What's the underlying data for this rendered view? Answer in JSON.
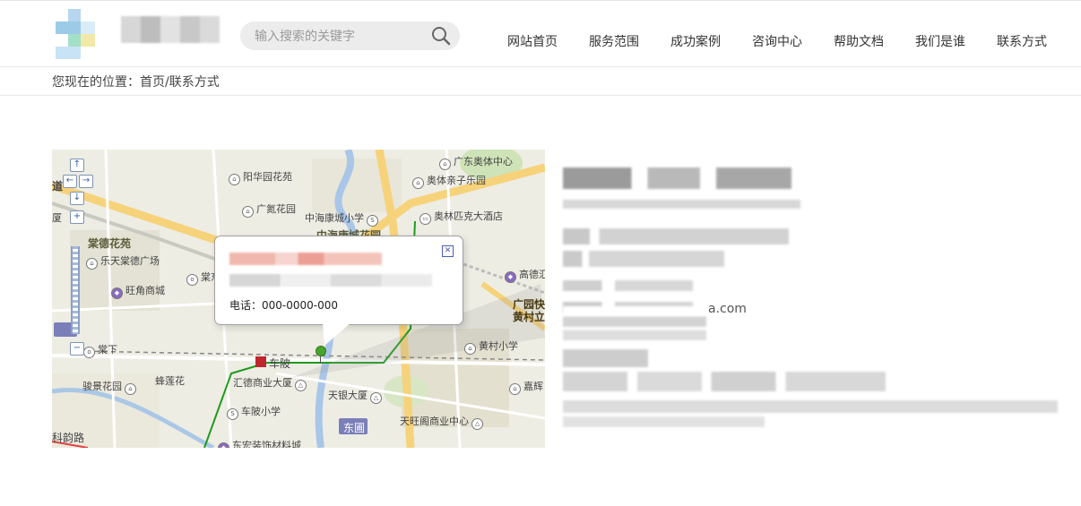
{
  "header": {
    "search": {
      "placeholder": "输入搜索的关键字"
    },
    "nav": [
      "网站首页",
      "服务范围",
      "成功案例",
      "咨询中心",
      "帮助文档",
      "我们是谁",
      "联系方式"
    ]
  },
  "breadcrumb": {
    "text": "您现在的位置：首页/联系方式"
  },
  "map": {
    "labels": [
      {
        "text": "阳华园花苑"
      },
      {
        "text": "广东奥体中心"
      },
      {
        "text": "奥体亲子乐园"
      },
      {
        "text": "广氮花园"
      },
      {
        "text": "中海康城小学"
      },
      {
        "text": "奥林匹克大酒店"
      },
      {
        "text": "中海康城花园"
      },
      {
        "text": "棠德花苑"
      },
      {
        "text": "乐天棠德广场"
      },
      {
        "text": "棠东"
      },
      {
        "text": "旺角商城"
      },
      {
        "text": "高德汇"
      },
      {
        "text": "广园快"
      },
      {
        "text": "黄村立"
      },
      {
        "text": "黄村小学"
      },
      {
        "text": "棠下"
      },
      {
        "text": "骏景花园"
      },
      {
        "text": "蜂莲花"
      },
      {
        "text": "汇德商业大厦"
      },
      {
        "text": "车陂"
      },
      {
        "text": "天银大厦"
      },
      {
        "text": "嘉辉"
      },
      {
        "text": "车陂小学"
      },
      {
        "text": "东圃"
      },
      {
        "text": "天旺阁商业中心"
      },
      {
        "text": "东宏装饰材料城"
      },
      {
        "text": "科韵路"
      },
      {
        "text": "道"
      },
      {
        "text": "厦"
      }
    ],
    "popup": {
      "tel": "电话：000-0000-000"
    }
  },
  "contact": {
    "email_suffix": "a.com"
  }
}
